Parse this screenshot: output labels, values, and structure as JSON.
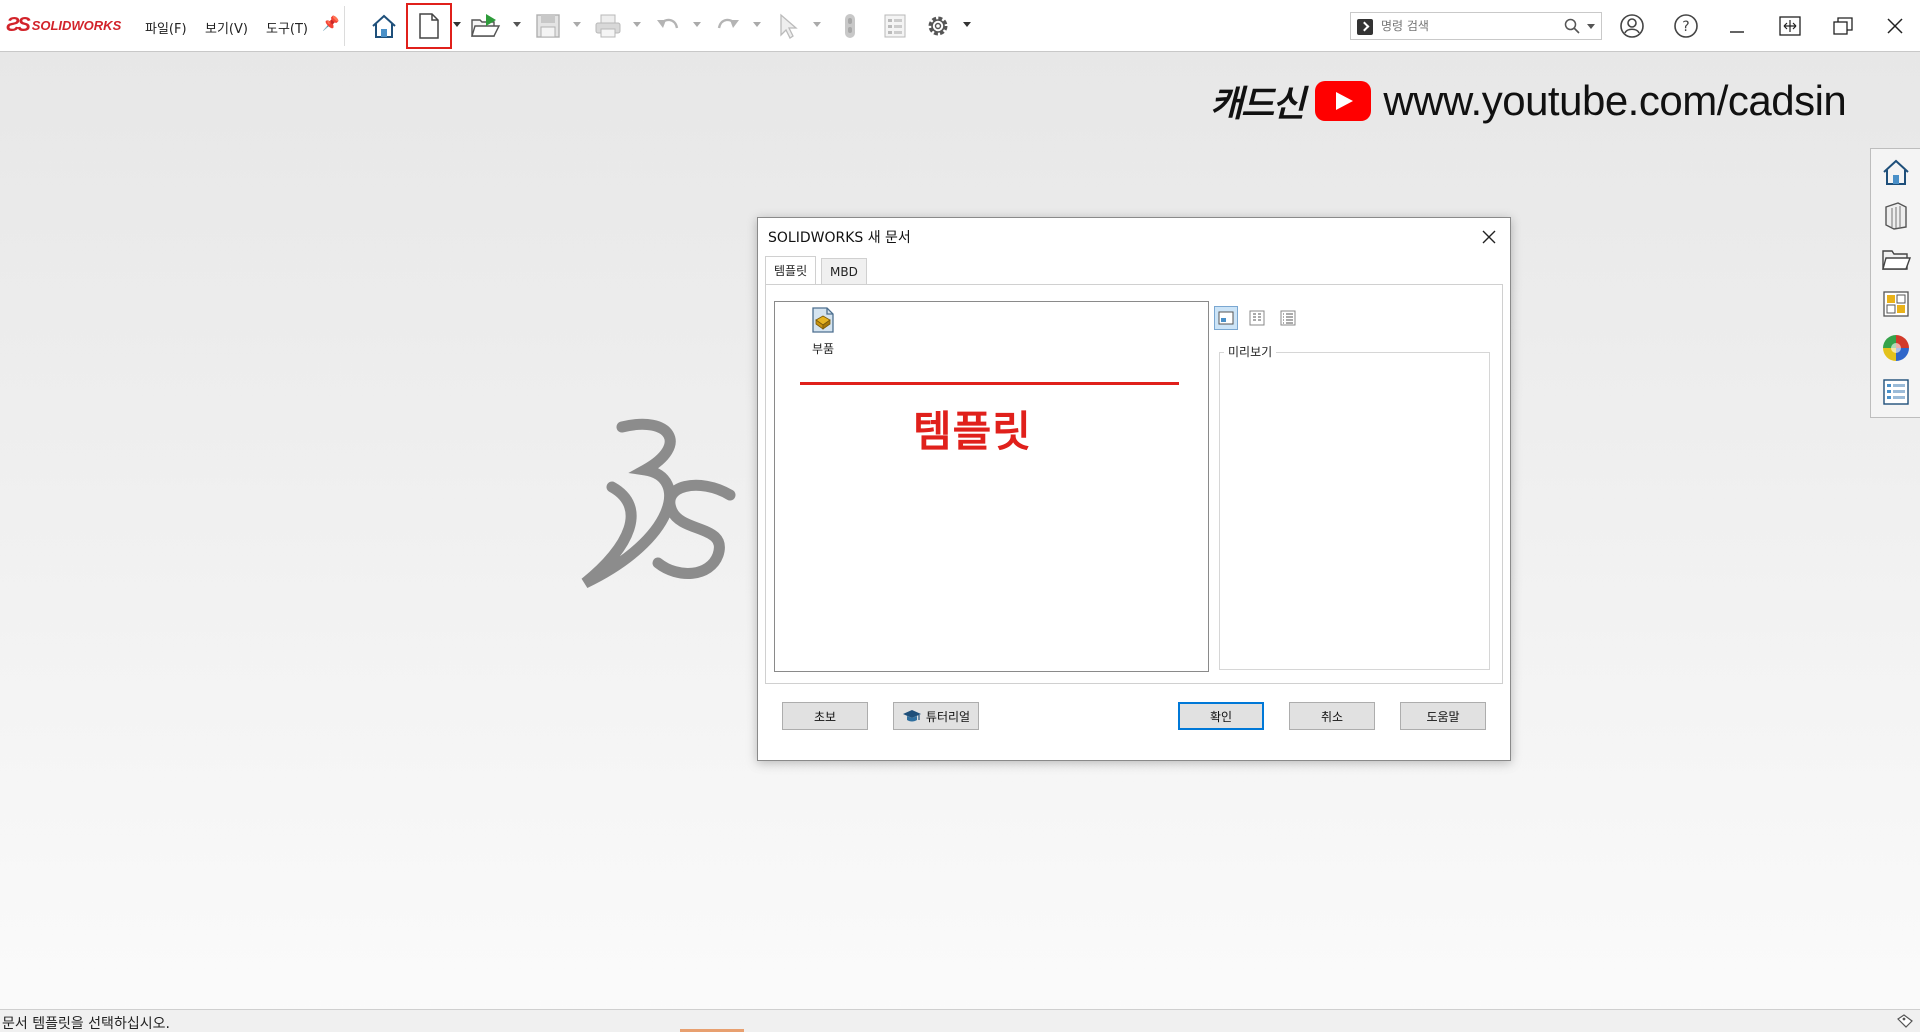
{
  "app": {
    "brand": "SOLIDWORKS",
    "menus": [
      "파일(F)",
      "보기(V)",
      "도구(T)"
    ]
  },
  "search": {
    "placeholder": "명령 검색"
  },
  "banner": {
    "name": "캐드신",
    "url": "www.youtube.com/cadsin"
  },
  "dialog": {
    "title": "SOLIDWORKS 새 문서",
    "tabs": [
      "템플릿",
      "MBD"
    ],
    "template_item": "부품",
    "annotation": "템플릿",
    "preview_label": "미리보기",
    "buttons": {
      "novice": "초보",
      "tutorial": "튜터리얼",
      "ok": "확인",
      "cancel": "취소",
      "help": "도움말"
    }
  },
  "status": {
    "text": "문서 템플릿을 선택하십시오."
  },
  "colors": {
    "accent": "#0078d7",
    "highlight": "#e0201b",
    "brand": "#d2232a"
  },
  "icons": [
    "home-icon",
    "new-document-icon",
    "open-icon",
    "save-icon",
    "print-icon",
    "undo-icon",
    "redo-icon",
    "select-icon",
    "rebuild-icon",
    "file-properties-icon",
    "options-icon",
    "user-icon",
    "help-icon",
    "minimize-icon",
    "restore-icon",
    "maximize-icon",
    "close-icon"
  ]
}
